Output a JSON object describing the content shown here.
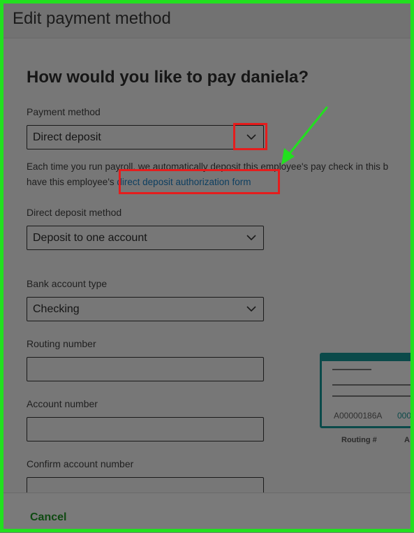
{
  "dialog": {
    "title": "Edit payment method"
  },
  "heading": "How would you like to pay daniela?",
  "payment_method": {
    "label": "Payment method",
    "value": "Direct deposit"
  },
  "info": {
    "text_line1": "Each time you run payroll, we automatically deposit this employee's pay check in this b",
    "text_line2_prefix": "have this employee's ",
    "link_text": "direct deposit authorization form"
  },
  "deposit_method": {
    "label": "Direct deposit method",
    "value": "Deposit to one account"
  },
  "bank_account_type": {
    "label": "Bank account type",
    "value": "Checking"
  },
  "routing_number": {
    "label": "Routing number",
    "value": ""
  },
  "account_number": {
    "label": "Account number",
    "value": ""
  },
  "confirm_account_number": {
    "label": "Confirm account number",
    "value": ""
  },
  "check_illustration": {
    "routing_sample": "A00000186A",
    "account_sample": "000",
    "routing_caption": "Routing #",
    "account_caption": "A"
  },
  "footer": {
    "cancel_label": "Cancel"
  },
  "colors": {
    "annotation_frame": "#22e01f",
    "annotation_box": "#e51d1d",
    "annotation_arrow": "#22e01f",
    "link": "#0d3f61",
    "check_accent": "#0b4a4a",
    "cancel": "#0f4a12"
  }
}
